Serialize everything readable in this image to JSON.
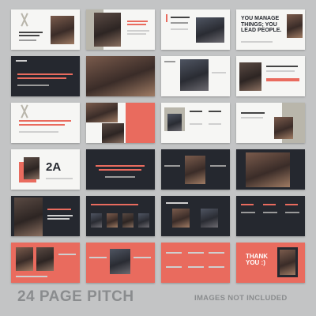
{
  "slide_texts": {
    "s4": "YOU MANAGE THINGS; YOU LEAD PEOPLE.",
    "s24": "THANK YOU :)"
  },
  "footer": {
    "title": "24 PAGE PITCH",
    "note": "IMAGES NOT INCLUDED"
  },
  "colors": {
    "coral": "#e96b5e",
    "navy": "#25282f",
    "white": "#f6f6f4",
    "taupe": "#b9b6ab",
    "background": "#c3c4c5"
  }
}
